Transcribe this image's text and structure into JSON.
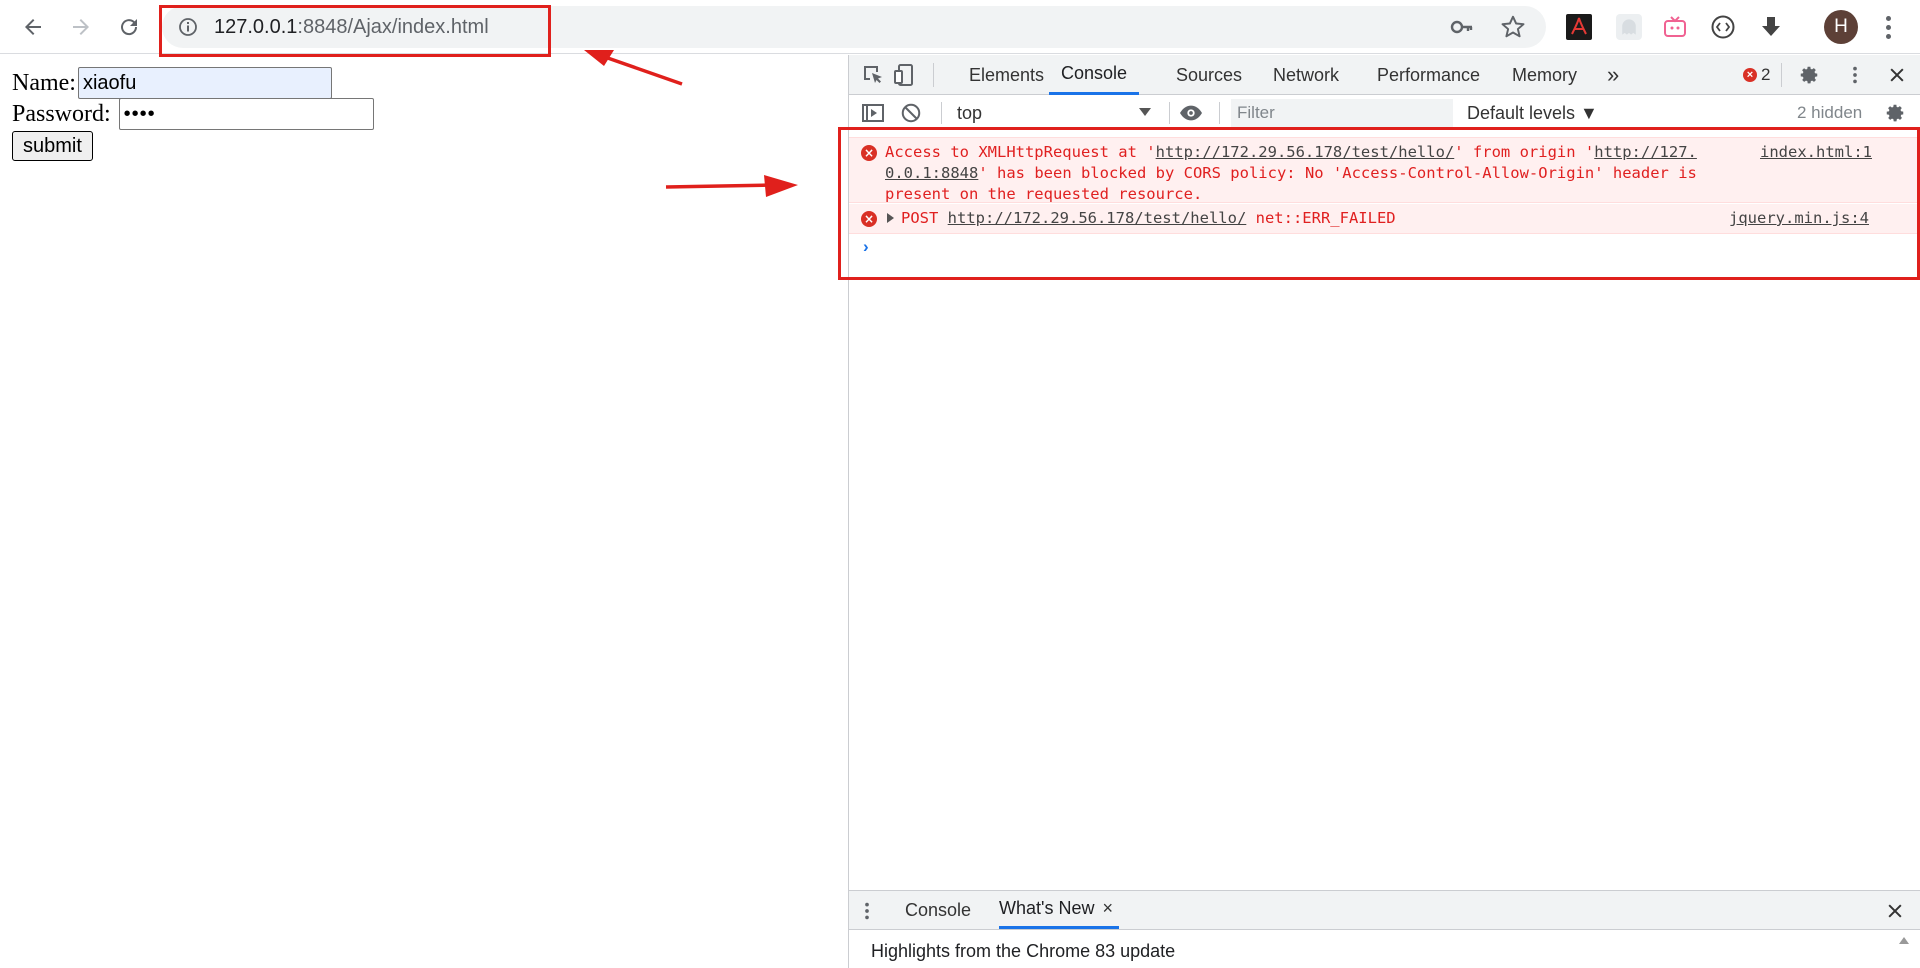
{
  "browser": {
    "url_host": "127.0.0.1",
    "url_rest": ":8848/Ajax/index.html",
    "profile_initial": "H",
    "icons": {
      "back": "back-arrow-icon",
      "forward": "forward-arrow-icon",
      "reload": "reload-icon",
      "info": "info-icon",
      "key": "key-icon",
      "star": "bookmark-star-icon",
      "menu": "more-vertical-icon"
    },
    "extensions": [
      "pdf-extension-icon",
      "ghost-extension-icon",
      "tv-extension-icon",
      "code-extension-icon",
      "download-icon"
    ]
  },
  "form": {
    "name_label": "Name:",
    "name_value": "xiaofu",
    "password_label": "Password:",
    "password_value": "••••",
    "submit_label": "submit"
  },
  "devtools": {
    "tabs": [
      "Elements",
      "Console",
      "Sources",
      "Network",
      "Performance",
      "Memory"
    ],
    "active_tab": "Console",
    "more_tabs": "»",
    "error_count": "2",
    "context": "top",
    "filter_placeholder": "Filter",
    "levels": "Default levels ▼",
    "hidden_count": "2 hidden",
    "messages": [
      {
        "prefix": "Access to XMLHttpRequest at '",
        "link": "http://172.29.56.178/test/hello/",
        "middle": "' from origin '",
        "origin_part1": "http://127.",
        "origin_part2": "0.0.1:8848",
        "rest": "' has been blocked by CORS policy: No 'Access-Control-Allow-Origin' header is present on the requested resource.",
        "source": "index.html:1"
      },
      {
        "method": "POST",
        "link": "http://172.29.56.178/test/hello/",
        "status": "net::ERR_FAILED",
        "source": "jquery.min.js:4"
      }
    ],
    "drawer": {
      "tabs": [
        "Console",
        "What's New"
      ],
      "active_tab": "What's New",
      "close_symbol": "×",
      "content": "Highlights from the Chrome 83 update"
    }
  },
  "colors": {
    "annotation": "#e0201c",
    "error_text": "#e02020",
    "error_bg": "#fff0f0",
    "active_tab_underline": "#1a73e8"
  }
}
